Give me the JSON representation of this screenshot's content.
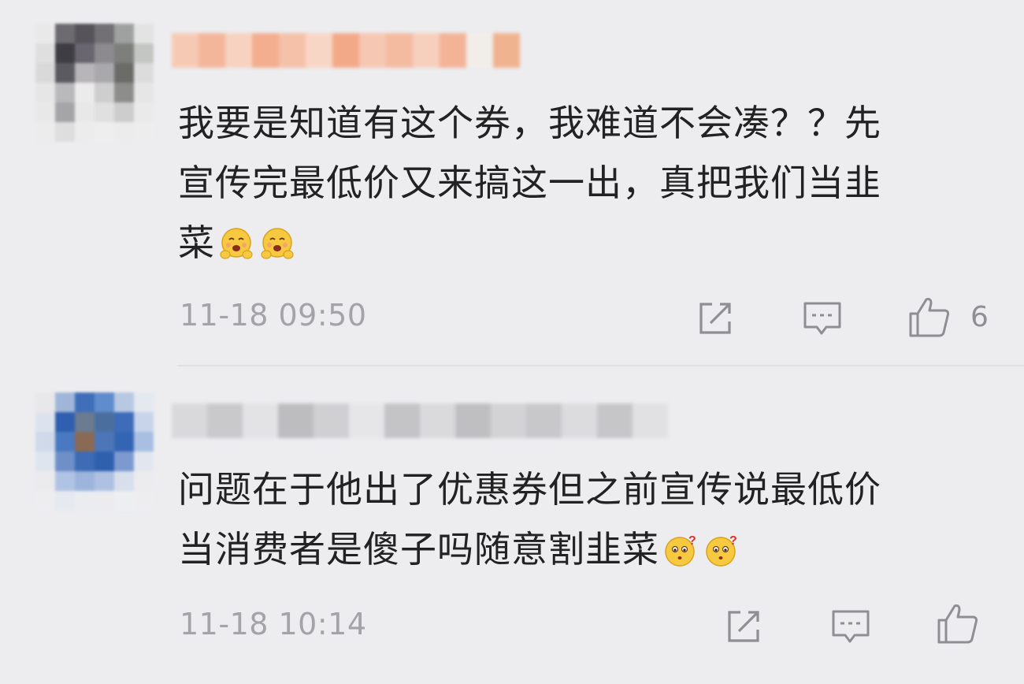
{
  "comments": [
    {
      "lines": [
        "我要是知道有这个券，我难道不会凑？？先",
        "宣传完最低价又来搞这一出，真把我们当韭",
        "菜"
      ],
      "emojis": [
        "hug-emoji",
        "hug-emoji"
      ],
      "time": "11-18 09:50",
      "likes": "6",
      "avatar_colors": [
        "#e9e9ea",
        "#6d6b6f",
        "#56545a",
        "#727075",
        "#9fa1a0",
        "#e3e3e3",
        "#dfdfe0",
        "#3f3d44",
        "#6a6670",
        "#8d8a8f",
        "#7e7f7b",
        "#c4c6c4",
        "#d9d9da",
        "#5c5a61",
        "#b7b5b8",
        "#a9a8ab",
        "#6b6c68",
        "#dcdcdc",
        "#e6e6e6",
        "#b9b8bb",
        "#ecebec",
        "#cfcecf",
        "#8d8d8b",
        "#e6e6e6",
        "#e8e8e8",
        "#a5a4a7",
        "#e8e8e8",
        "#e0e0e0",
        "#cdcdcd",
        "#eaeaea",
        "#ececec",
        "#dedede",
        "#ececec",
        "#eeeeee",
        "#ececec",
        "#ededed"
      ],
      "name_colors": [
        "#f6c9b5",
        "#f4b69a",
        "#f7d2c0",
        "#f3ae8f",
        "#f5c1a9",
        "#f8d6c6",
        "#f2a988",
        "#f6c7b2",
        "#f4bba1",
        "#f7cfbd",
        "#f3b397",
        "#f1eee9",
        "#f0b38f"
      ]
    },
    {
      "lines": [
        "问题在于他出了优惠券但之前宣传说最低价",
        "当消费者是傻子吗随意割韭菜"
      ],
      "emojis": [
        "question-emoji",
        "question-emoji"
      ],
      "time": "11-18 10:14",
      "likes": "",
      "avatar_colors": [
        "#e8e8ea",
        "#9fb6d9",
        "#3f6fb8",
        "#5f8ccc",
        "#b7c8e3",
        "#e4e8ef",
        "#dde3ee",
        "#2f5fae",
        "#6b7b90",
        "#4a6f9f",
        "#3e6cb8",
        "#c7d4ea",
        "#cfd9ea",
        "#4979c0",
        "#8a6a55",
        "#4d76b9",
        "#3465b3",
        "#a9bfe2",
        "#dfe5ef",
        "#6e8fc8",
        "#3d6bb5",
        "#2f60ae",
        "#7d9ad0",
        "#e2e7ef",
        "#ebebee",
        "#b0c3e4",
        "#9db5dc",
        "#aec1e2",
        "#d7dfec",
        "#ececee",
        "#ededef",
        "#e6e9ef",
        "#eaecf0",
        "#ececee",
        "#edeeef",
        "#ededef"
      ],
      "name_colors": [
        "#d9d9db",
        "#c9c9cc",
        "#e3e3e5",
        "#bdbdc0",
        "#d0d0d3",
        "#e6e6e8",
        "#c4c4c7",
        "#dadadc",
        "#bfbfc2",
        "#d3d3d5",
        "#c8c8cb",
        "#dcdcde",
        "#c6c6c9",
        "#e1e1e3"
      ]
    }
  ]
}
